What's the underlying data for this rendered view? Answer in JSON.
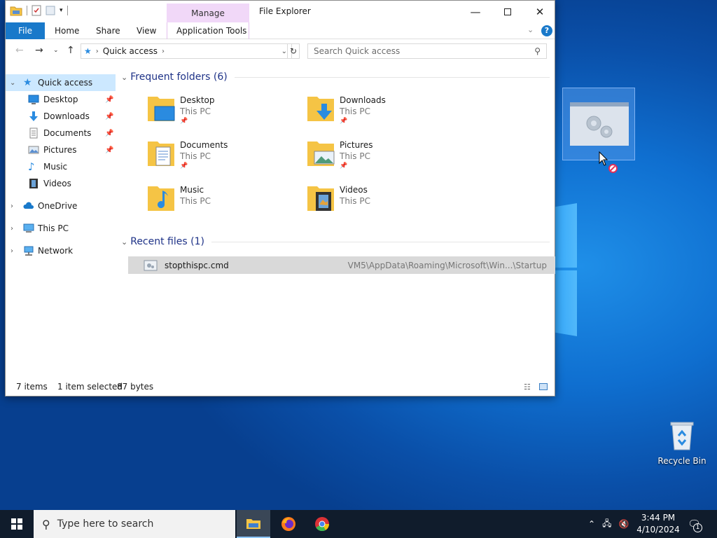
{
  "window": {
    "title": "File Explorer",
    "context_tab": "Manage",
    "min_icon": "minimize-icon",
    "max_icon": "maximize-icon",
    "close_icon": "close-icon"
  },
  "ribbon": {
    "tabs": [
      "File",
      "Home",
      "Share",
      "View",
      "Application Tools"
    ]
  },
  "address": {
    "location": "Quick access",
    "search_placeholder": "Search Quick access"
  },
  "nav": {
    "items": [
      {
        "label": "Quick access",
        "icon": "star-icon",
        "selected": true
      },
      {
        "label": "Desktop",
        "icon": "desktop-icon",
        "pinned": true
      },
      {
        "label": "Downloads",
        "icon": "download-icon",
        "pinned": true
      },
      {
        "label": "Documents",
        "icon": "documents-icon",
        "pinned": true
      },
      {
        "label": "Pictures",
        "icon": "pictures-icon",
        "pinned": true
      },
      {
        "label": "Music",
        "icon": "music-icon"
      },
      {
        "label": "Videos",
        "icon": "videos-icon"
      },
      {
        "label": "OneDrive",
        "icon": "cloud-icon"
      },
      {
        "label": "This PC",
        "icon": "computer-icon"
      },
      {
        "label": "Network",
        "icon": "network-icon"
      }
    ]
  },
  "frequent": {
    "title": "Frequent folders (6)",
    "folders": [
      {
        "name": "Desktop",
        "location": "This PC",
        "pinned": true
      },
      {
        "name": "Downloads",
        "location": "This PC",
        "pinned": true
      },
      {
        "name": "Documents",
        "location": "This PC",
        "pinned": true
      },
      {
        "name": "Pictures",
        "location": "This PC",
        "pinned": true
      },
      {
        "name": "Music",
        "location": "This PC"
      },
      {
        "name": "Videos",
        "location": "This PC"
      }
    ]
  },
  "recent": {
    "title": "Recent files (1)",
    "files": [
      {
        "name": "stopthispc.cmd",
        "path": "VM5\\AppData\\Roaming\\Microsoft\\Win...\\Startup"
      }
    ]
  },
  "status": {
    "items": "7 items",
    "selected": "1 item selected",
    "size": "87 bytes"
  },
  "desktop": {
    "recycle_bin": "Recycle Bin"
  },
  "taskbar": {
    "search_placeholder": "Type here to search",
    "time": "3:44 PM",
    "date": "4/10/2024",
    "notification_count": "1"
  },
  "colors": {
    "accent": "#1979ca",
    "selection": "#cce8ff",
    "context_tab": "#f1d8f8",
    "group_title": "#1e3287"
  }
}
